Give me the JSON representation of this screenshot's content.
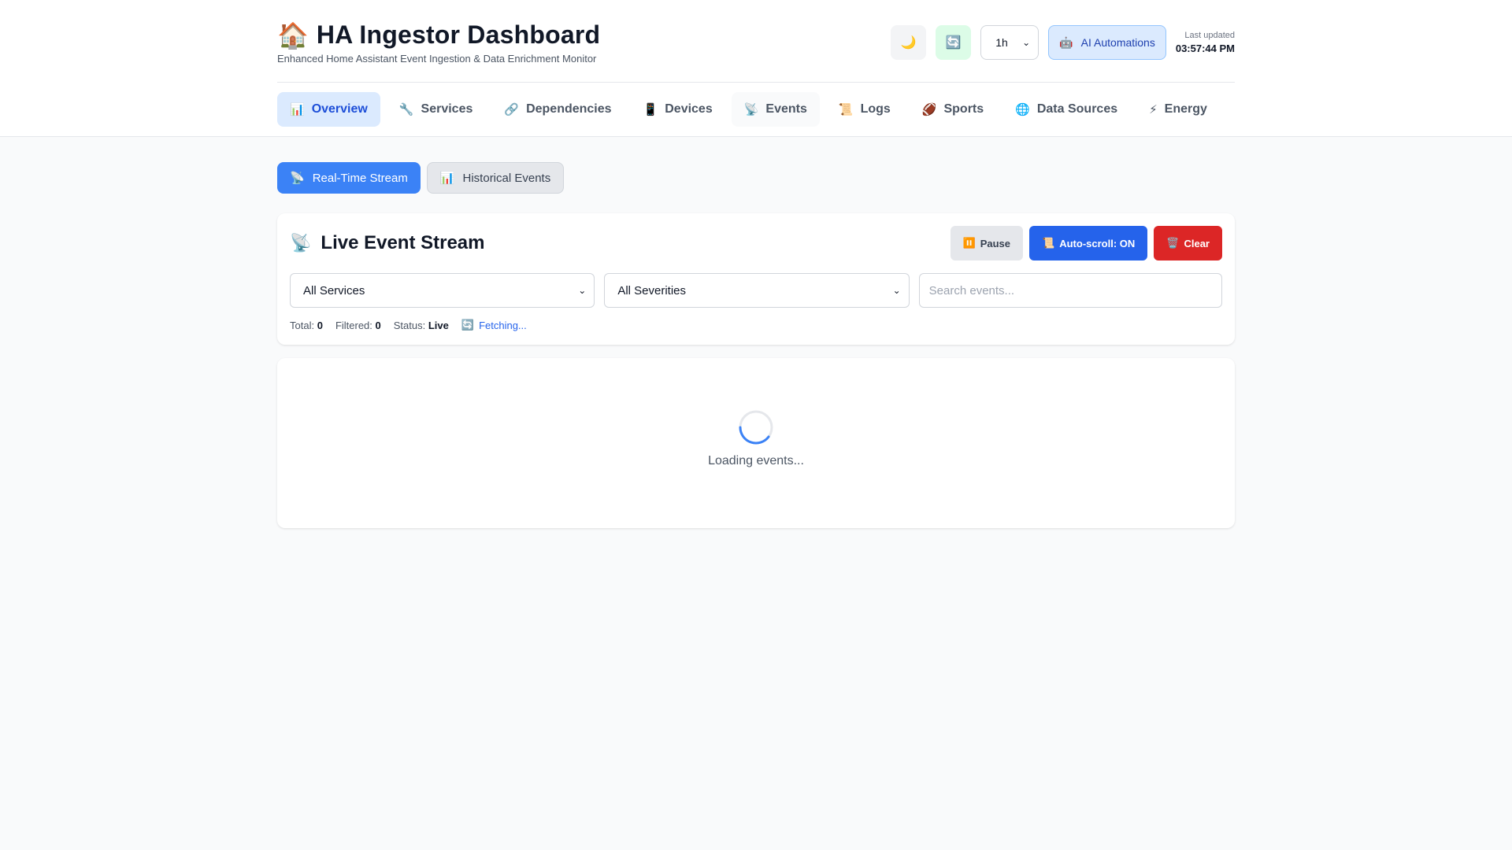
{
  "header": {
    "title": "HA Ingestor Dashboard",
    "subtitle": "Enhanced Home Assistant Event Ingestion & Data Enrichment Monitor",
    "logo_icon": "🏠",
    "theme_icon": "🌙",
    "refresh_icon": "🔄",
    "time_range": "1h",
    "ai_button_icon": "🤖",
    "ai_button_label": "AI Automations",
    "last_updated_label": "Last updated",
    "last_updated_value": "03:57:44 PM"
  },
  "nav": {
    "tabs": [
      {
        "icon": "📊",
        "label": "Overview"
      },
      {
        "icon": "🔧",
        "label": "Services"
      },
      {
        "icon": "🔗",
        "label": "Dependencies"
      },
      {
        "icon": "📱",
        "label": "Devices"
      },
      {
        "icon": "📡",
        "label": "Events"
      },
      {
        "icon": "📜",
        "label": "Logs"
      },
      {
        "icon": "🏈",
        "label": "Sports"
      },
      {
        "icon": "🌐",
        "label": "Data Sources"
      },
      {
        "icon": "⚡",
        "label": "Energy"
      }
    ]
  },
  "subtabs": [
    {
      "icon": "📡",
      "label": "Real-Time Stream"
    },
    {
      "icon": "📊",
      "label": "Historical Events"
    }
  ],
  "stream": {
    "title_icon": "📡",
    "title": "Live Event Stream",
    "pause_icon": "⏸️",
    "pause_label": "Pause",
    "autoscroll_icon": "📜",
    "autoscroll_label": "Auto-scroll: ON",
    "clear_icon": "🗑️",
    "clear_label": "Clear",
    "service_filter": "All Services",
    "severity_filter": "All Severities",
    "search_placeholder": "Search events...",
    "total_label": "Total:",
    "total_value": "0",
    "filtered_label": "Filtered:",
    "filtered_value": "0",
    "status_label": "Status:",
    "status_value": "Live",
    "fetching_icon": "🔄",
    "fetching_label": "Fetching..."
  },
  "loading": {
    "text": "Loading events..."
  },
  "colors": {
    "primary": "#3b82f6",
    "primary_dark": "#2563eb",
    "danger": "#dc2626",
    "active_tab_bg": "#dbeafe"
  }
}
